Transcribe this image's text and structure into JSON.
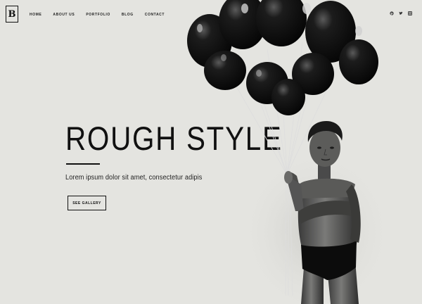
{
  "brand": {
    "logo_letter": "B"
  },
  "nav": {
    "items": [
      "Home",
      "About Us",
      "Portfolio",
      "Blog",
      "Contact"
    ]
  },
  "social": {
    "icons": [
      "pinterest-icon",
      "twitter-icon",
      "instagram-icon"
    ]
  },
  "hero": {
    "title": "ROUGH STYLE",
    "subtitle": "Lorem ipsum dolor sit amet, consectetur adipis",
    "button_label": "SEE GALLERY"
  },
  "colors": {
    "background": "#e4e4e0",
    "text": "#111111",
    "balloon": "#0c0c0c"
  }
}
